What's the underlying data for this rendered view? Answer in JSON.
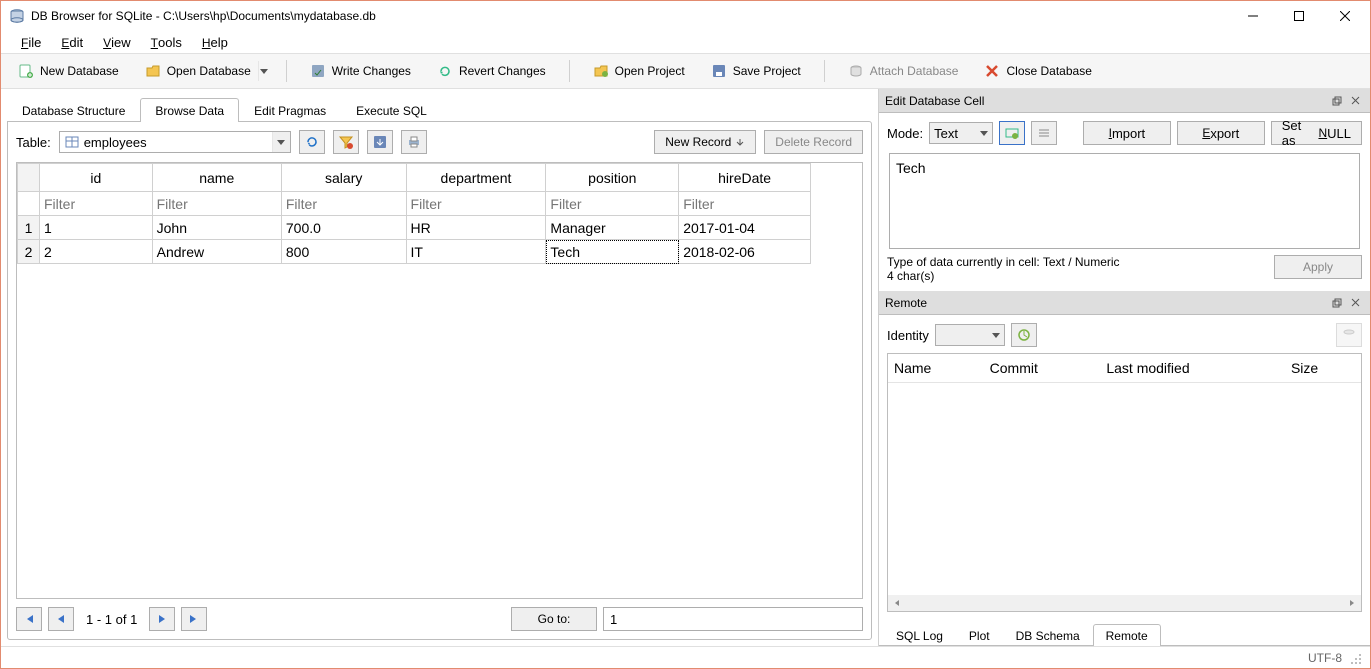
{
  "window": {
    "title": "DB Browser for SQLite - C:\\Users\\hp\\Documents\\mydatabase.db"
  },
  "menu": {
    "file": "File",
    "edit": "Edit",
    "view": "View",
    "tools": "Tools",
    "help": "Help"
  },
  "toolbar": {
    "new_db": "New Database",
    "open_db": "Open Database",
    "write_changes": "Write Changes",
    "revert_changes": "Revert Changes",
    "open_project": "Open Project",
    "save_project": "Save Project",
    "attach_db": "Attach Database",
    "close_db": "Close Database"
  },
  "main_tabs": {
    "structure": "Database Structure",
    "browse": "Browse Data",
    "pragmas": "Edit Pragmas",
    "execute": "Execute SQL"
  },
  "browse": {
    "table_label": "Table:",
    "table_selected": "employees",
    "new_record": "New Record",
    "delete_record": "Delete Record",
    "columns": [
      "id",
      "name",
      "salary",
      "department",
      "position",
      "hireDate"
    ],
    "filter_placeholder": "Filter",
    "rows": [
      {
        "num": "1",
        "cells": [
          "1",
          "John",
          "700.0",
          "HR",
          "Manager",
          "2017-01-04"
        ]
      },
      {
        "num": "2",
        "cells": [
          "2",
          "Andrew",
          "800",
          "IT",
          "Tech",
          "2018-02-06"
        ]
      }
    ],
    "selected": {
      "row": 1,
      "col": 4
    }
  },
  "pager": {
    "range": "1 - 1 of 1",
    "goto_label": "Go to:",
    "goto_value": "1"
  },
  "edit_cell": {
    "title": "Edit Database Cell",
    "mode_label": "Mode:",
    "mode_value": "Text",
    "import": "Import",
    "export": "Export",
    "set_null": "Set as NULL",
    "value": "Tech",
    "type_line": "Type of data currently in cell: Text / Numeric",
    "chars_line": "4 char(s)",
    "apply": "Apply"
  },
  "remote": {
    "title": "Remote",
    "identity_label": "Identity",
    "columns": [
      "Name",
      "Commit",
      "Last modified",
      "Size"
    ]
  },
  "bottom_tabs": {
    "sql_log": "SQL Log",
    "plot": "Plot",
    "db_schema": "DB Schema",
    "remote": "Remote"
  },
  "status": {
    "encoding": "UTF-8"
  }
}
